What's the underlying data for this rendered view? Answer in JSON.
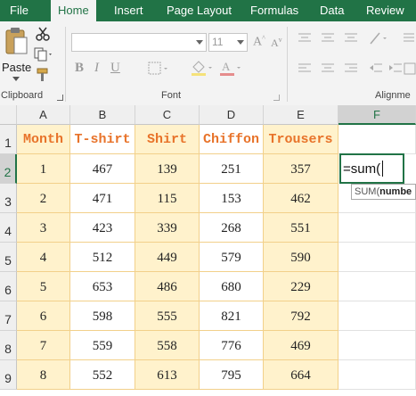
{
  "ribbon": {
    "tabs": [
      {
        "name": "tab-file",
        "label": "File"
      },
      {
        "name": "tab-home",
        "label": "Home"
      },
      {
        "name": "tab-insert",
        "label": "Insert"
      },
      {
        "name": "tab-page-layout",
        "label": "Page Layout"
      },
      {
        "name": "tab-formulas",
        "label": "Formulas"
      },
      {
        "name": "tab-data",
        "label": "Data"
      },
      {
        "name": "tab-review",
        "label": "Review"
      }
    ],
    "paste_label": "Paste",
    "groups": {
      "clipboard": "Clipboard",
      "font": "Font",
      "alignment": "Alignme"
    },
    "font_size": "11",
    "font_name": ""
  },
  "sheet": {
    "columns": [
      "A",
      "B",
      "C",
      "D",
      "E",
      "F"
    ],
    "rows": [
      "1",
      "2",
      "3",
      "4",
      "5",
      "6",
      "7",
      "8",
      "9"
    ],
    "headers": [
      "Month",
      "T-shirt",
      "Shirt",
      "Chiffon",
      "Trousers"
    ],
    "data": [
      [
        "1",
        "467",
        "139",
        "251",
        "357"
      ],
      [
        "2",
        "471",
        "115",
        "153",
        "462"
      ],
      [
        "3",
        "423",
        "339",
        "268",
        "551"
      ],
      [
        "4",
        "512",
        "449",
        "579",
        "590"
      ],
      [
        "5",
        "653",
        "486",
        "680",
        "229"
      ],
      [
        "6",
        "598",
        "555",
        "821",
        "792"
      ],
      [
        "7",
        "559",
        "558",
        "776",
        "469"
      ],
      [
        "8",
        "552",
        "613",
        "795",
        "664"
      ]
    ],
    "active_cell_value": "=sum(",
    "tooltip": {
      "fn": "SUM(",
      "arg": "numbe"
    }
  },
  "colors": {
    "accent": "#217346",
    "header_text": "#e8732a",
    "fill_alt": "#fff2cc",
    "border": "#f2d08a"
  }
}
